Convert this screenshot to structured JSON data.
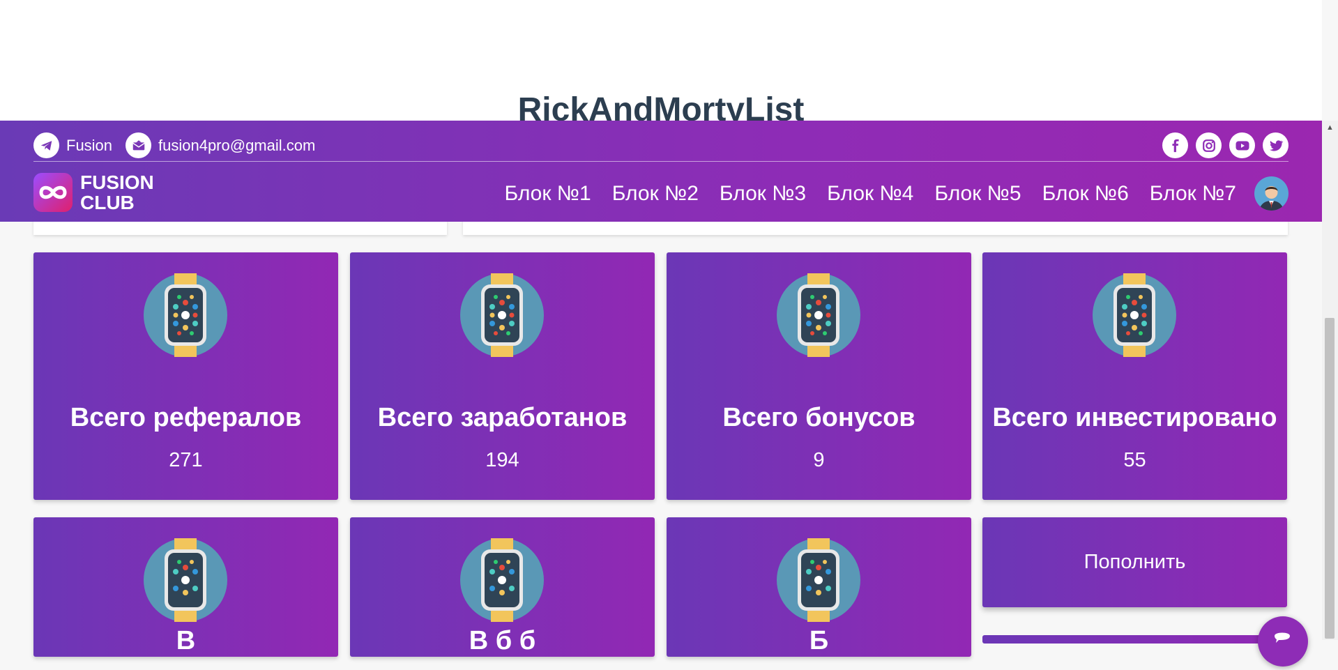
{
  "page": {
    "title": "RickAndMortyList"
  },
  "header": {
    "telegram_label": "Fusion",
    "email": "fusion4pro@gmail.com",
    "logo_line1": "FUSION",
    "logo_line2": "CLUB",
    "nav": [
      "Блок №1",
      "Блок №2",
      "Блок №3",
      "Блок №4",
      "Блок №5",
      "Блок №6",
      "Блок №7"
    ],
    "socials": [
      "facebook-icon",
      "instagram-icon",
      "youtube-icon",
      "twitter-icon"
    ]
  },
  "stats": [
    {
      "title": "Всего рефералов",
      "value": "271"
    },
    {
      "title": "Всего заработанов",
      "value": "194"
    },
    {
      "title": "Всего бонусов",
      "value": "9"
    },
    {
      "title": "Всего инвестировано",
      "value": "55"
    }
  ],
  "bottom_cards": [
    {
      "title": "В"
    },
    {
      "title": "В         б б"
    },
    {
      "title": "Б"
    }
  ],
  "actions": {
    "top_up_label": "Пополнить"
  },
  "colors": {
    "gradient_start": "#6b37b6",
    "gradient_end": "#9228b4",
    "title_color": "#2c3e50"
  }
}
